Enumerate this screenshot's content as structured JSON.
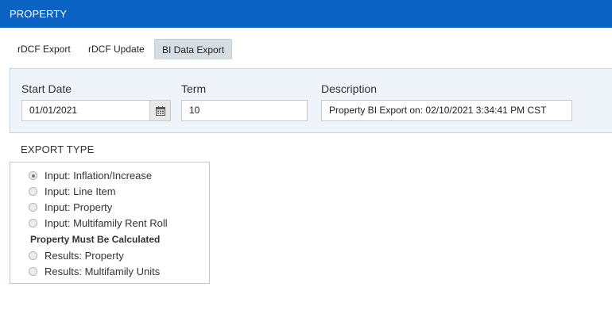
{
  "header": {
    "title": "PROPERTY"
  },
  "tabs": [
    {
      "label": "rDCF Export",
      "active": false
    },
    {
      "label": "rDCF Update",
      "active": false
    },
    {
      "label": "BI Data Export",
      "active": true
    }
  ],
  "form": {
    "start_date": {
      "label": "Start Date",
      "value": "01/01/2021",
      "button_icon": "calendar-icon"
    },
    "term": {
      "label": "Term",
      "value": "10"
    },
    "description": {
      "label": "Description",
      "value": "Property BI Export on: 02/10/2021 3:34:41 PM CST"
    }
  },
  "export_type": {
    "title": "EXPORT TYPE",
    "options": [
      {
        "label": "Input: Inflation/Increase",
        "checked": true
      },
      {
        "label": "Input: Line Item",
        "checked": false
      },
      {
        "label": "Input: Property",
        "checked": false
      },
      {
        "label": "Input: Multifamily Rent Roll",
        "checked": false
      }
    ],
    "results_heading": "Property Must Be Calculated",
    "results_options": [
      {
        "label": "Results: Property",
        "checked": false
      },
      {
        "label": "Results: Multifamily Units",
        "checked": false
      }
    ]
  },
  "colors": {
    "header_bg": "#0a62c3",
    "active_tab_bg": "#d6dde3",
    "panel_bg": "#eef4f9"
  }
}
